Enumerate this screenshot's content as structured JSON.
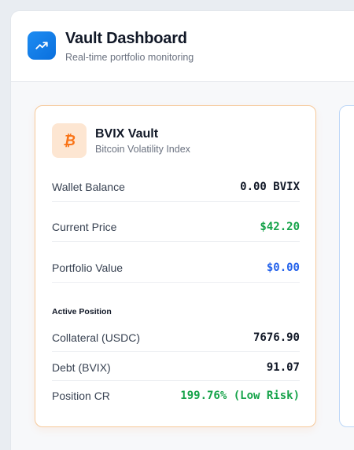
{
  "app": {
    "title": "Vault Dashboard",
    "subtitle": "Real-time portfolio monitoring"
  },
  "vault": {
    "name": "BVIX Vault",
    "description": "Bitcoin Volatility Index",
    "icon": "bitcoin-icon",
    "accent_color": "#f97316",
    "stats": [
      {
        "label": "Wallet Balance",
        "value": "0.00 BVIX"
      },
      {
        "label": "Current Price",
        "value": "$42.20"
      },
      {
        "label": "Portfolio Value",
        "value": "$0.00"
      }
    ],
    "position": {
      "title": "Active Position",
      "rows": [
        {
          "label": "Collateral (USDC)",
          "value": "7676.90"
        },
        {
          "label": "Debt (BVIX)",
          "value": "91.07"
        },
        {
          "label": "Position CR",
          "value": "199.76% (Low Risk)"
        }
      ]
    }
  },
  "colors": {
    "positive": "#16a34a",
    "link": "#2563eb",
    "brand": "#1d8cf2"
  }
}
